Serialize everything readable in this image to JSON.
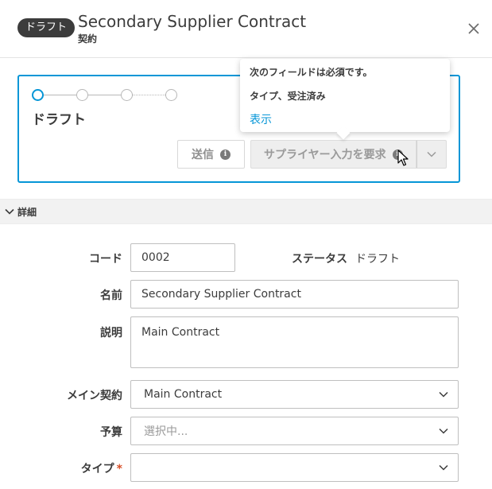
{
  "header": {
    "badge": "ドラフト",
    "title": "Secondary Supplier Contract",
    "subtitle": "契約"
  },
  "workflow": {
    "steps": [
      "active",
      "pending",
      "pending",
      "pending"
    ],
    "stage_label": "ドラフト",
    "send_label": "送信",
    "request_label": "サプライヤー入力を要求"
  },
  "tooltip": {
    "line1": "次のフィールドは必須です。",
    "line2": "タイプ、受注済み",
    "link": "表示"
  },
  "section": {
    "label": "詳細"
  },
  "form": {
    "code_label": "コード",
    "code_value": "0002",
    "status_label": "ステータス",
    "status_value": "ドラフト",
    "name_label": "名前",
    "name_value": "Secondary Supplier Contract",
    "description_label": "説明",
    "description_value": "Main Contract",
    "main_contract_label": "メイン契約",
    "main_contract_value": "Main Contract",
    "budget_label": "予算",
    "budget_placeholder": "選択中...",
    "type_label": "タイプ",
    "type_required": "*",
    "type_value": ""
  },
  "colors": {
    "accent": "#0696d7",
    "badge_bg": "#3c3c3c",
    "required": "#d74e26"
  }
}
